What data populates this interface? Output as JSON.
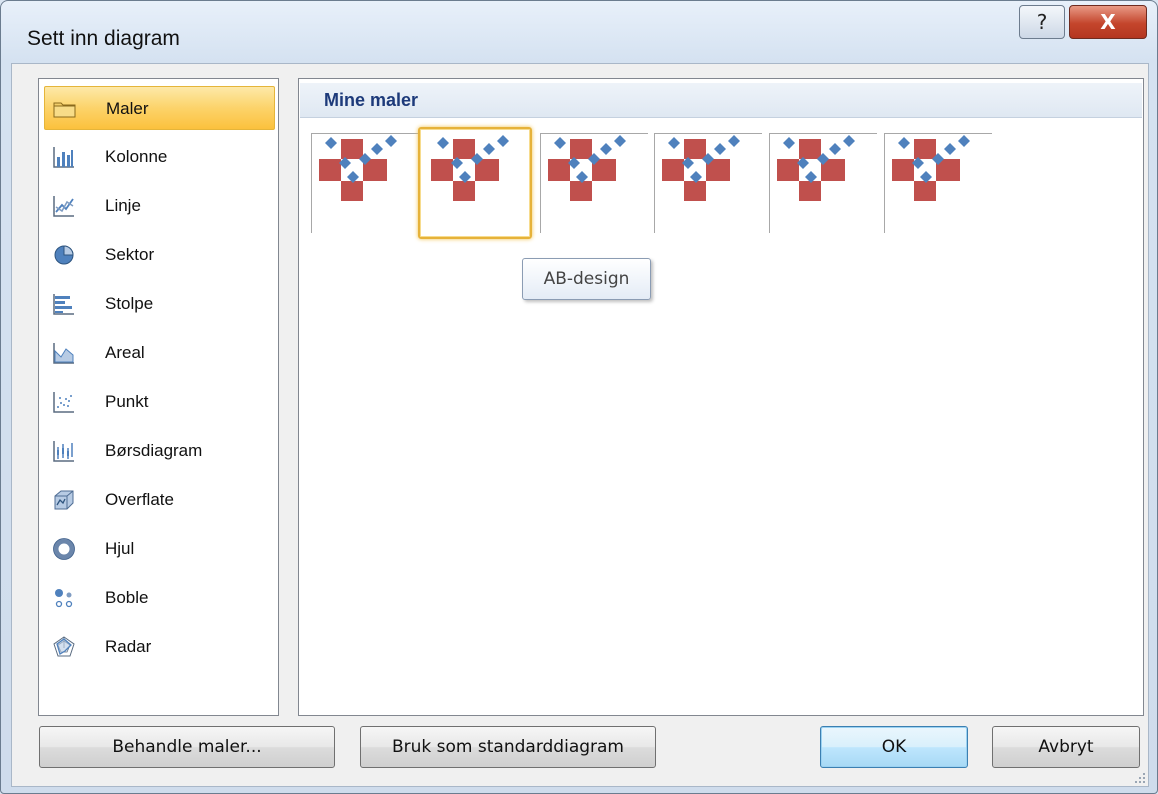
{
  "window": {
    "title": "Sett inn diagram",
    "help_label": "?",
    "close_label": "X"
  },
  "categories": [
    {
      "label": "Maler",
      "icon": "folder-icon",
      "selected": true
    },
    {
      "label": "Kolonne",
      "icon": "column-chart-icon"
    },
    {
      "label": "Linje",
      "icon": "line-chart-icon"
    },
    {
      "label": "Sektor",
      "icon": "pie-chart-icon"
    },
    {
      "label": "Stolpe",
      "icon": "bar-chart-icon"
    },
    {
      "label": "Areal",
      "icon": "area-chart-icon"
    },
    {
      "label": "Punkt",
      "icon": "scatter-chart-icon"
    },
    {
      "label": "Børsdiagram",
      "icon": "stock-chart-icon"
    },
    {
      "label": "Overflate",
      "icon": "surface-chart-icon"
    },
    {
      "label": "Hjul",
      "icon": "doughnut-chart-icon"
    },
    {
      "label": "Boble",
      "icon": "bubble-chart-icon"
    },
    {
      "label": "Radar",
      "icon": "radar-chart-icon"
    }
  ],
  "templates": {
    "group_title": "Mine maler",
    "count": 6,
    "selected_index": 1,
    "tooltip": "AB-design",
    "colors": {
      "square": "#c0504d",
      "diamond": "#4f81bd"
    }
  },
  "buttons": {
    "manage": "Behandle maler...",
    "set_default": "Bruk som standarddiagram",
    "ok": "OK",
    "cancel": "Avbryt"
  }
}
